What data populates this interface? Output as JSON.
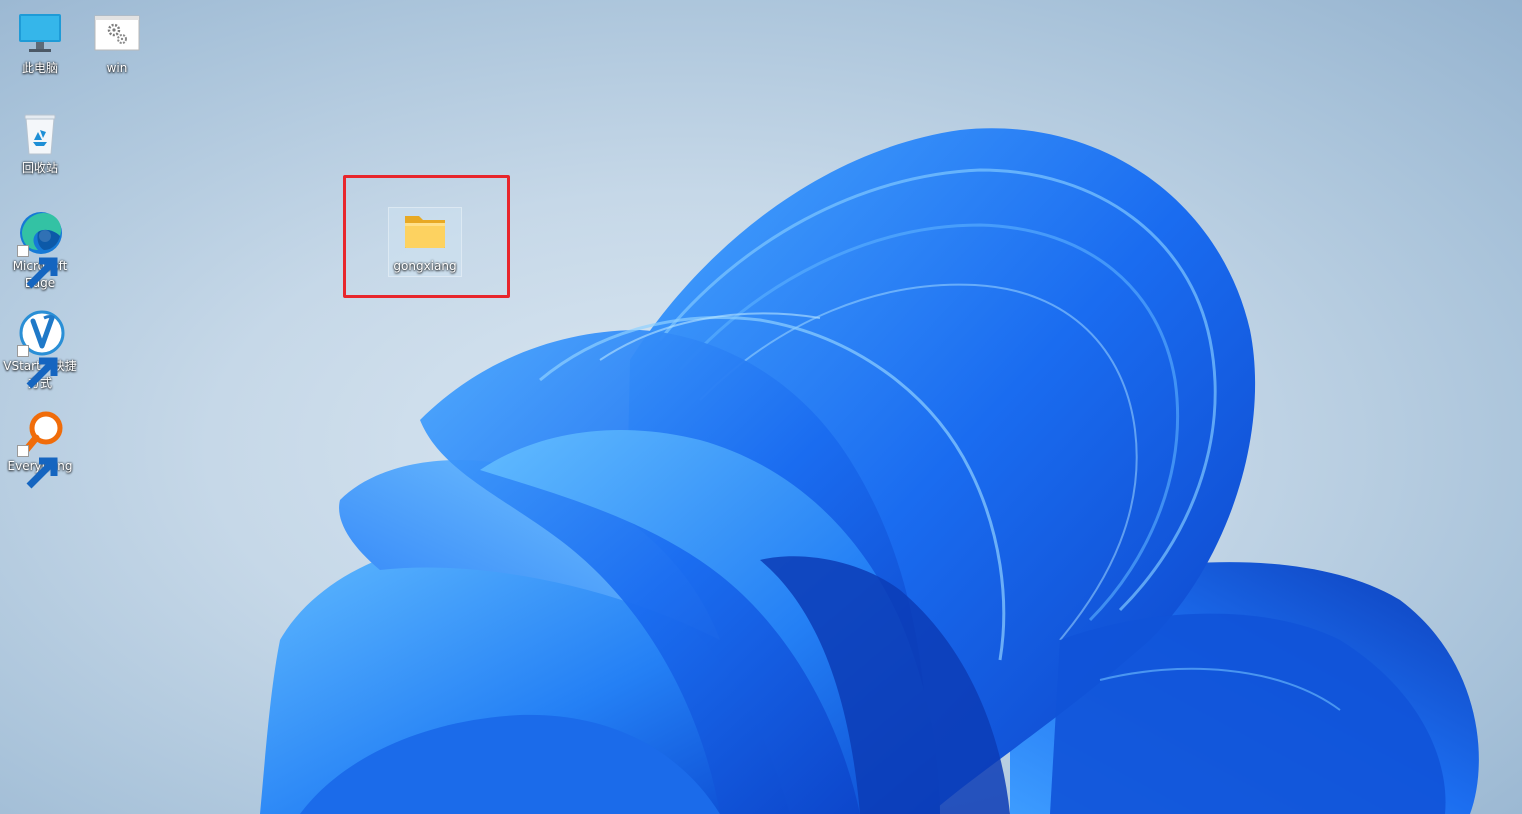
{
  "desktop": {
    "icons": [
      {
        "label": "此电脑",
        "icon": "monitor-icon"
      },
      {
        "label": "win",
        "icon": "settings-window-icon"
      },
      {
        "label": "回收站",
        "icon": "recycle-bin-icon"
      },
      {
        "label": "Microsoft Edge",
        "icon": "edge-icon"
      },
      {
        "label": "VStart - 快捷方式",
        "icon": "vstart-icon"
      },
      {
        "label": "Everything",
        "icon": "everything-search-icon"
      },
      {
        "label": "gongxiang",
        "icon": "folder-icon"
      }
    ],
    "highlight_color": "#e8262c"
  }
}
